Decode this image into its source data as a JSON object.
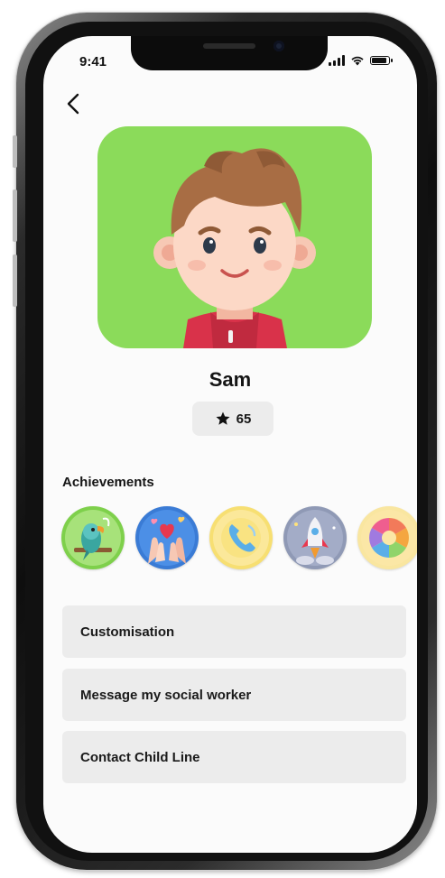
{
  "status_bar": {
    "time": "9:41"
  },
  "navigation": {
    "back_icon": "chevron-left-icon"
  },
  "profile": {
    "name": "Sam",
    "points": "65",
    "points_icon": "star-icon",
    "avatar_bg": "#8bdb5a"
  },
  "achievements": {
    "title": "Achievements",
    "badges": [
      {
        "icon": "parrot-icon"
      },
      {
        "icon": "hands-heart-icon"
      },
      {
        "icon": "phone-icon"
      },
      {
        "icon": "rocket-icon"
      },
      {
        "icon": "color-wheel-icon"
      }
    ]
  },
  "menu": [
    {
      "label": "Customisation"
    },
    {
      "label": "Message my social worker"
    },
    {
      "label": "Contact Child Line"
    }
  ],
  "colors": {
    "card_bg": "#ececec",
    "accent_green": "#8bdb5a"
  }
}
